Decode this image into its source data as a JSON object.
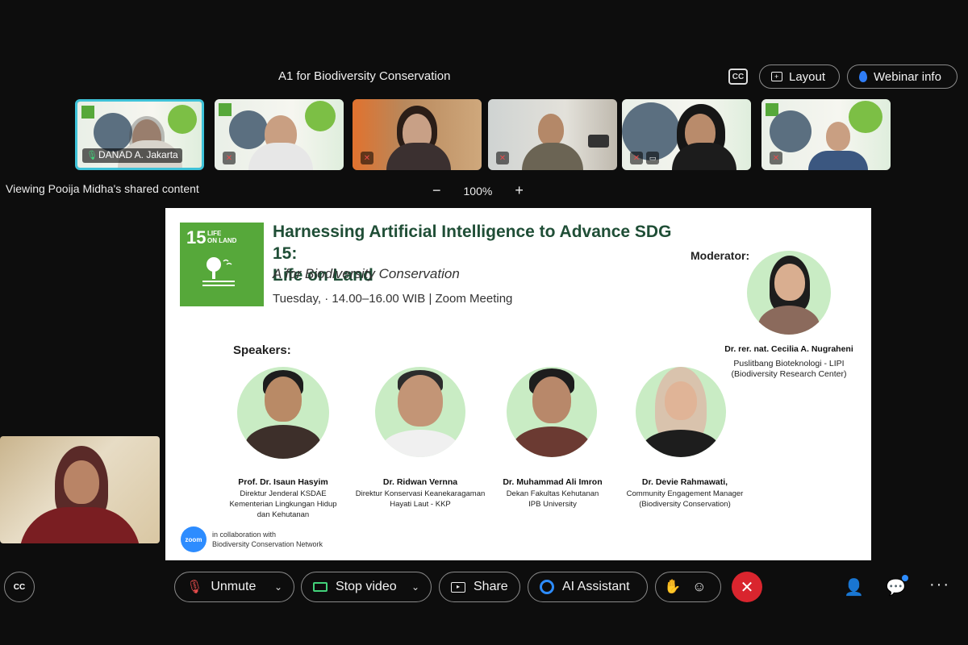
{
  "header": {
    "meeting_title": "A1 for Biodiversity Conservation",
    "cc_label": "CC",
    "layout_label": "Layout",
    "webinar_info_label": "Webinar info"
  },
  "participants": [
    {
      "name": "DANAD A. Jakarta",
      "active": true
    },
    {
      "name": ""
    },
    {
      "name": ""
    },
    {
      "name": ""
    },
    {
      "name": ""
    },
    {
      "name": ""
    }
  ],
  "share": {
    "viewing_text": "Viewing Pooija Midha's shared content",
    "zoom_minus": "−",
    "zoom_level": "100%",
    "zoom_plus": "+"
  },
  "slide": {
    "sdg_number": "15",
    "sdg_label_1": "LIFE",
    "sdg_label_2": "ON LAND",
    "title_line1": "Harnessing Artificial Intelligence to Advance SDG 15:",
    "title_line2": "Life on Land",
    "subtitle": "A for Biodiversity Conservation",
    "schedule": "Tuesday,  ·  14.00–16.00 WIB  |  Zoom Meeting",
    "moderator_label": "Moderator:",
    "moderator": {
      "name": "Dr. rer. nat. Cecilia A. Nugraheni",
      "role_line1": "Puslitbang Bioteknologi - LIPI",
      "role_line2": "(Biodiversity Research Center)"
    },
    "speakers_label": "Speakers:",
    "speakers": [
      {
        "name": "Prof. Dr. Isaun Hasyim",
        "role_line1": "Direktur Jenderal KSDAE",
        "role_line2": "Kementerian Lingkungan Hidup",
        "role_line3": "dan Kehutanan"
      },
      {
        "name": "Dr. Ridwan Vernna",
        "role_line1": "Direktur Konservasi Keanekaragaman",
        "role_line2": "Hayati Laut - KKP",
        "role_line3": ""
      },
      {
        "name": "Dr. Muhammad Ali Imron",
        "role_line1": "Dekan Fakultas Kehutanan",
        "role_line2": "IPB University",
        "role_line3": ""
      },
      {
        "name": "Dr. Devie Rahmawati,",
        "role_line1": "Community Engagement Manager",
        "role_line2": "(Biodiversity Conservation)",
        "role_line3": ""
      }
    ],
    "zoom_logo_text": "zoom",
    "collab_line1": "in collaboration with",
    "collab_line2": "Biodiversity Conservation Network"
  },
  "controls": {
    "cc_label": "CC",
    "unmute_label": "Unmute",
    "stop_video_label": "Stop video",
    "share_label": "Share",
    "ai_assistant_label": "AI Assistant"
  },
  "colors": {
    "background": "#0d0d0d",
    "sdg_green": "#56a83a",
    "end_red": "#d9252e",
    "accent_blue": "#2d8cff",
    "active_border": "#3ec2d8"
  }
}
